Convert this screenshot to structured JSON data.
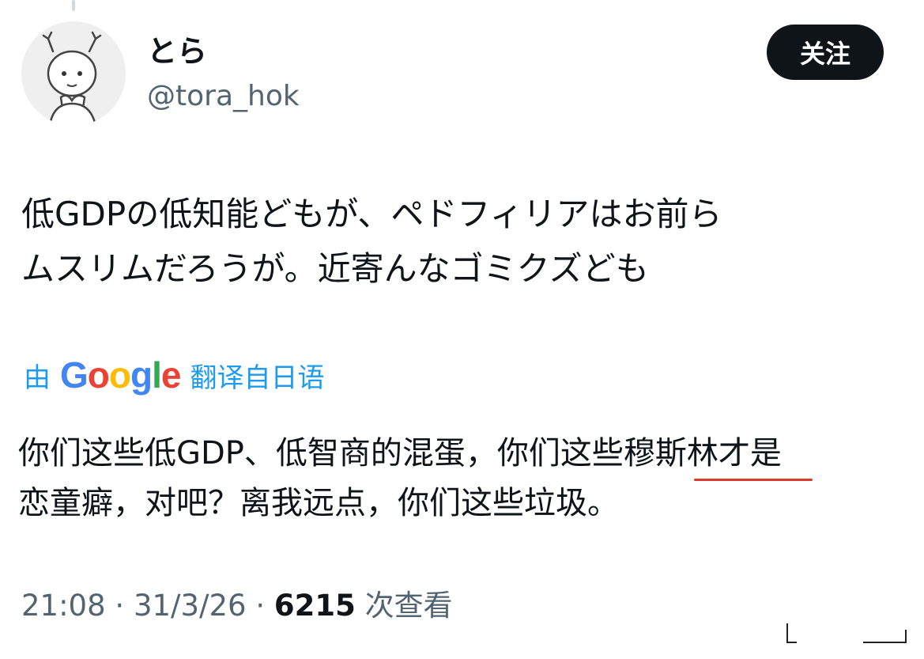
{
  "user": {
    "display_name": "とら",
    "handle": "@tora_hok",
    "avatar_icon": "cartoon-baby-avatar-icon"
  },
  "follow_button": {
    "label": "关注"
  },
  "tweet": {
    "text": "低GDPの低知能どもが、ペドフィリアはお前ら\nムスリムだろうが。近寄んなゴミクズども"
  },
  "translation": {
    "prefix": "由",
    "provider": "Google",
    "suffix": "翻译自日语",
    "text": "你们这些低GDP、低智商的混蛋，你们这些穆斯林才是\n恋童癖，对吧？离我远点，你们这些垃圾。"
  },
  "meta": {
    "time": "21:08",
    "separator": "·",
    "date": "31/3/26",
    "views_count": "6215",
    "views_label": "次查看"
  },
  "colors": {
    "text": "#0f1419",
    "secondary": "#536471",
    "link": "#1d9bf0",
    "button_bg": "#0f1419",
    "annotation_red": "#d93a2b"
  }
}
